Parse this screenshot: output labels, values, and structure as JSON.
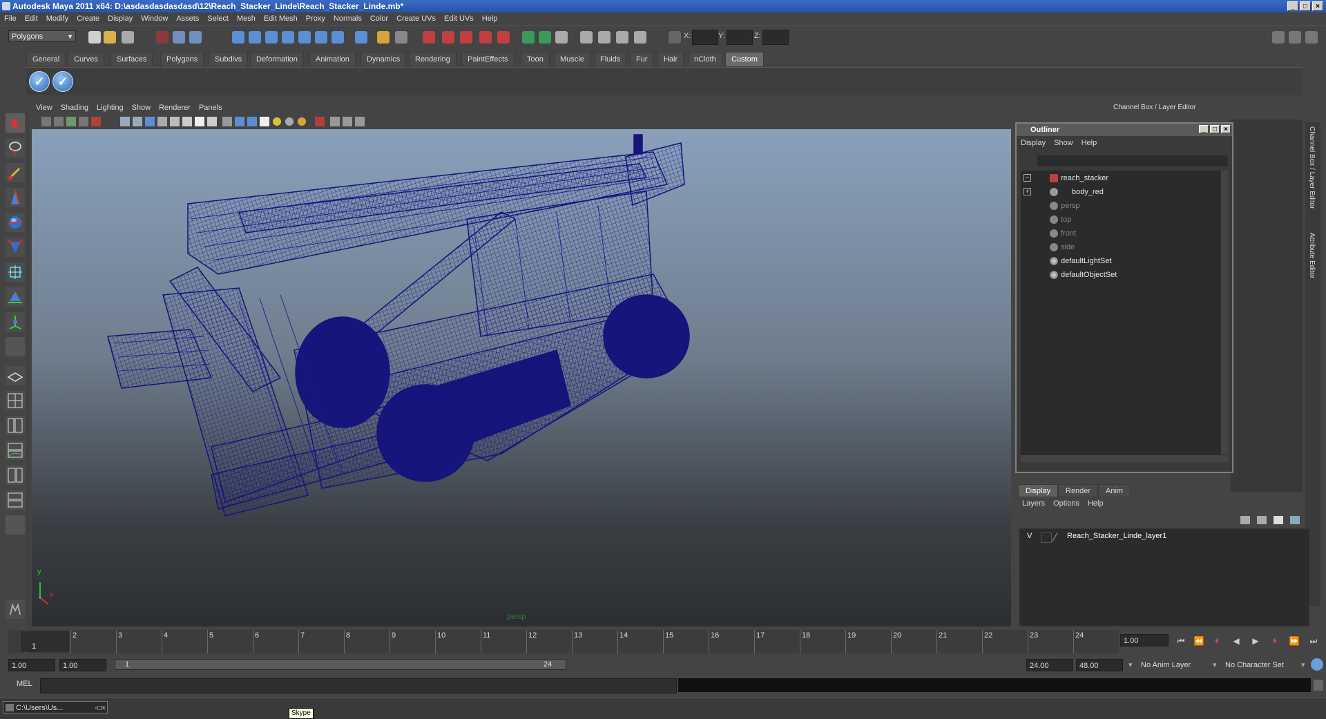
{
  "title": "Autodesk Maya 2011 x64: D:\\asdasdasdasdasd\\12\\Reach_Stacker_Linde\\Reach_Stacker_Linde.mb*",
  "menubar": [
    "File",
    "Edit",
    "Modify",
    "Create",
    "Display",
    "Window",
    "Assets",
    "Select",
    "Mesh",
    "Edit Mesh",
    "Proxy",
    "Normals",
    "Color",
    "Create UVs",
    "Edit UVs",
    "Help"
  ],
  "statusline": {
    "mode": "Polygons",
    "x_label": "X:",
    "y_label": "Y:",
    "z_label": "Z:"
  },
  "shelf_tabs": [
    "General",
    "Curves",
    "Surfaces",
    "Polygons",
    "Subdivs",
    "Deformation",
    "Animation",
    "Dynamics",
    "Rendering",
    "PaintEffects",
    "Toon",
    "Muscle",
    "Fluids",
    "Fur",
    "Hair",
    "nCloth",
    "Custom"
  ],
  "shelf_active": "Custom",
  "viewport": {
    "menu": [
      "View",
      "Shading",
      "Lighting",
      "Show",
      "Renderer",
      "Panels"
    ],
    "camera_label": "persp",
    "axis_y": "y",
    "axis_x": "x",
    "wireframe_color": "#13137a"
  },
  "right_panel": {
    "title": "Channel Box / Layer Editor",
    "side_tabs": [
      "Channel Box / Layer Editor",
      "Attribute Editor"
    ]
  },
  "outliner": {
    "title": "Outliner",
    "menu": [
      "Display",
      "Show",
      "Help"
    ],
    "items": [
      {
        "label": "reach_stacker",
        "dim": false,
        "indent": 0
      },
      {
        "label": "body_red",
        "dim": false,
        "indent": 1
      },
      {
        "label": "persp",
        "dim": true,
        "indent": 0
      },
      {
        "label": "top",
        "dim": true,
        "indent": 0
      },
      {
        "label": "front",
        "dim": true,
        "indent": 0
      },
      {
        "label": "side",
        "dim": true,
        "indent": 0
      },
      {
        "label": "defaultLightSet",
        "dim": false,
        "indent": 0
      },
      {
        "label": "defaultObjectSet",
        "dim": false,
        "indent": 0
      }
    ]
  },
  "layer_editor": {
    "tabs": [
      "Display",
      "Render",
      "Anim"
    ],
    "menu": [
      "Layers",
      "Options",
      "Help"
    ],
    "layer_visibility": "V",
    "layer_name": "Reach_Stacker_Linde_layer1"
  },
  "timeline": {
    "ticks": [
      "1",
      "2",
      "3",
      "4",
      "5",
      "6",
      "7",
      "8",
      "9",
      "10",
      "11",
      "12",
      "13",
      "14",
      "15",
      "16",
      "17",
      "18",
      "19",
      "20",
      "21",
      "22",
      "23",
      "24"
    ],
    "current_frame_marker": "1",
    "current_time": "1.00"
  },
  "range": {
    "start": "1.00",
    "playback_start": "1.00",
    "slider_left": "1",
    "slider_right": "24",
    "playback_end": "24.00",
    "end": "48.00",
    "anim_layer": "No Anim Layer",
    "character_set": "No Character Set"
  },
  "command_line": {
    "label": "MEL"
  },
  "taskbar": {
    "item": "C:\\Users\\Us...",
    "tooltip": "Skype"
  }
}
